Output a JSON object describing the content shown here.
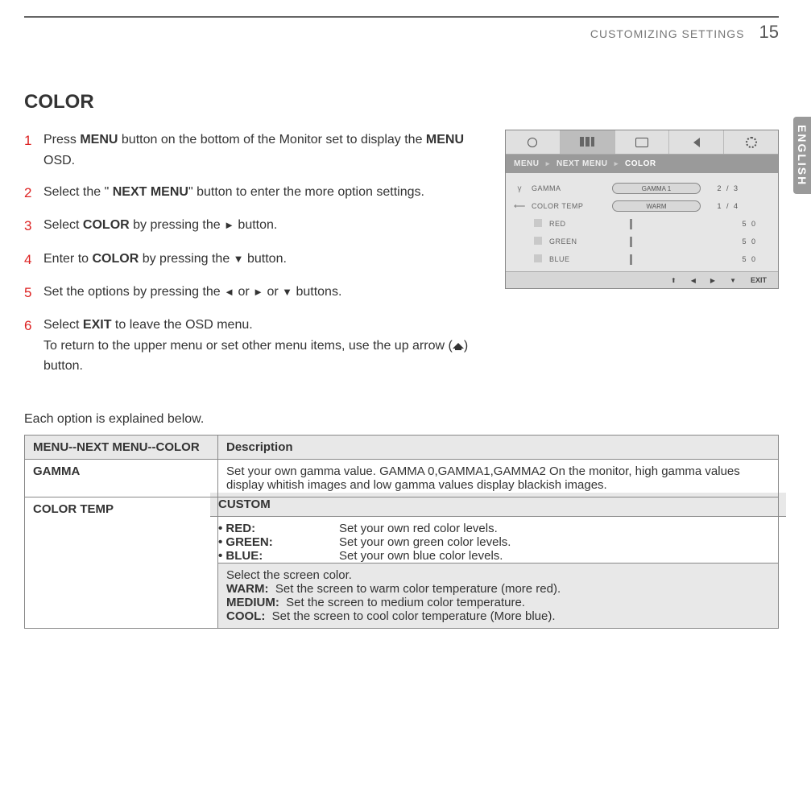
{
  "header": {
    "section": "CUSTOMIZING SETTINGS",
    "page_number": "15"
  },
  "lang_tab": "ENGLISH",
  "title": "COLOR",
  "steps": {
    "s1_a": "Press ",
    "s1_b": "MENU",
    "s1_c": " button on the bottom of the Monitor set to display  the ",
    "s1_d": "MENU",
    "s1_e": " OSD.",
    "s2_a": "Select the \" ",
    "s2_b": "NEXT MENU",
    "s2_c": "\" button to enter the more option settings.",
    "s3_a": "Select ",
    "s3_b": "COLOR",
    "s3_c": " by pressing the ",
    "s3_d": "►",
    "s3_e": " button.",
    "s4_a": "Enter to ",
    "s4_b": "COLOR",
    "s4_c": " by pressing the ",
    "s4_d": "▼",
    "s4_e": " button.",
    "s5_a": "Set the options by pressing the ",
    "s5_b": "◄",
    "s5_c": " or ",
    "s5_d": "►",
    "s5_e": " or ",
    "s5_f": "▼",
    "s5_g": " buttons.",
    "s6_a": "Select ",
    "s6_b": "EXIT",
    "s6_c": " to leave the OSD menu.",
    "s6_d": "To return to the upper menu or set other menu items, use the up arrow (",
    "s6_e": ") button."
  },
  "osd": {
    "breadcrumb": {
      "a": "MENU",
      "b": "NEXT MENU",
      "c": "COLOR"
    },
    "rows": {
      "gamma": {
        "label": "GAMMA",
        "pill": "GAMMA 1",
        "value": "2 / 3"
      },
      "ctemp": {
        "label": "COLOR TEMP",
        "pill": "WARM",
        "value": "1 / 4"
      },
      "red": {
        "label": "RED",
        "value": "5 0"
      },
      "green": {
        "label": "GREEN",
        "value": "5 0"
      },
      "blue": {
        "label": "BLUE",
        "value": "5 0"
      }
    },
    "footer": {
      "exit": "EXIT"
    }
  },
  "intro": "Each option is explained below.",
  "table": {
    "head_left": "MENU--NEXT MENU--COLOR",
    "head_right": "Description",
    "gamma_label": "GAMMA",
    "gamma_desc": "Set your own gamma value. GAMMA 0,GAMMA1,GAMMA2 On the monitor, high gamma values display  whitish images and low gamma values display  blackish images.",
    "ctemp_label": "COLOR TEMP",
    "custom_label": "CUSTOM",
    "red_k": "• RED:",
    "red_v": "Set your own red color levels.",
    "green_k": "• GREEN:",
    "green_v": "Set your own green color levels.",
    "blue_k": "• BLUE:",
    "blue_v": "Set your own blue color levels.",
    "select_line": "Select the screen color.",
    "warm_k": "WARM:",
    "warm_v": "Set the screen to warm color temperature (more red).",
    "medium_k": "MEDIUM:",
    "medium_v": "Set the screen to medium color temperature.",
    "cool_k": "COOL:",
    "cool_v": "Set the screen to cool color temperature (More blue)."
  }
}
